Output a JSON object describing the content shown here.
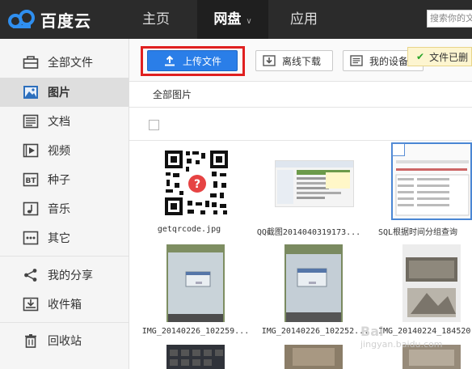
{
  "topbar": {
    "logo_text": "百度云",
    "nav": {
      "home": "主页",
      "pan": "网盘",
      "app": "应用"
    },
    "search_placeholder": "搜索你的文",
    "bg": "#2b2b2b"
  },
  "sidebar": {
    "items": [
      {
        "label": "全部文件",
        "icon": "briefcase-icon"
      },
      {
        "label": "图片",
        "icon": "image-icon"
      },
      {
        "label": "文档",
        "icon": "document-icon"
      },
      {
        "label": "视频",
        "icon": "video-icon"
      },
      {
        "label": "种子",
        "icon": "bt-icon"
      },
      {
        "label": "音乐",
        "icon": "music-icon"
      },
      {
        "label": "其它",
        "icon": "more-icon"
      },
      {
        "label": "我的分享",
        "icon": "share-icon"
      },
      {
        "label": "收件箱",
        "icon": "inbox-icon"
      },
      {
        "label": "回收站",
        "icon": "trash-icon"
      }
    ]
  },
  "toolbar": {
    "upload": "上传文件",
    "offline": "离线下载",
    "device": "我的设备",
    "toast": "文件已删",
    "accent": "#2a7ee8"
  },
  "main": {
    "crumb": "全部图片",
    "files": [
      "getqrcode.jpg",
      "QQ截图2014040319173...",
      "SQL根据时间分组查询",
      "IMG_20140226_102259...",
      "IMG_20140226_102252...",
      "IMG_20140224_184520"
    ]
  },
  "watermark": {
    "line1": "Bai",
    "line2": "jingyan.baidu.com"
  }
}
